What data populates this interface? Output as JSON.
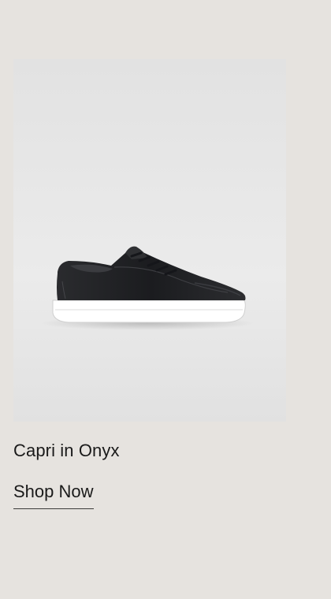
{
  "product": {
    "image_alt": "Capri in Onyx black leather sneaker",
    "name": "Capri in Onyx",
    "cta_label": "Shop Now"
  },
  "colors": {
    "page_background": "#e6e3df",
    "image_background": "#e6e6e6",
    "text": "#1a1a1a",
    "shoe_upper": "#1f2023",
    "shoe_sole": "#ffffff"
  }
}
